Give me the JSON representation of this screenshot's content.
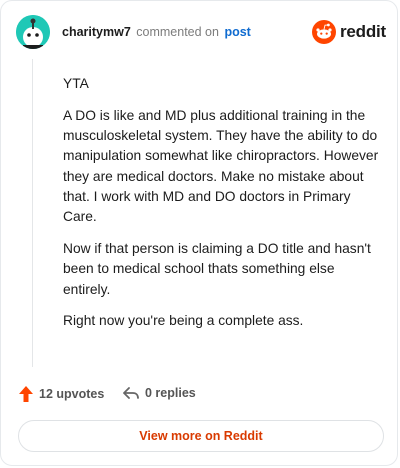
{
  "header": {
    "username": "charitymw7",
    "action_text": "commented on",
    "post_link": "post",
    "logo_text": "reddit",
    "brand_color": "#ff4500"
  },
  "comment": {
    "paragraphs": [
      "YTA",
      "A DO is like and MD plus additional training in the musculoskeletal system. They have the ability to do manipulation somewhat like chiropractors. However they are medical doctors. Make no mistake about that. I work with MD and DO doctors in Primary Care.",
      "Now if that person is claiming a DO title and hasn't been to medical school thats something else entirely.",
      "Right now you're being a complete ass."
    ]
  },
  "actions": {
    "upvotes": "12 upvotes",
    "replies": "0 replies",
    "upvote_icon": "arrow-up-icon",
    "reply_icon": "reply-arrow-icon"
  },
  "footer": {
    "view_more": "View more on Reddit"
  }
}
